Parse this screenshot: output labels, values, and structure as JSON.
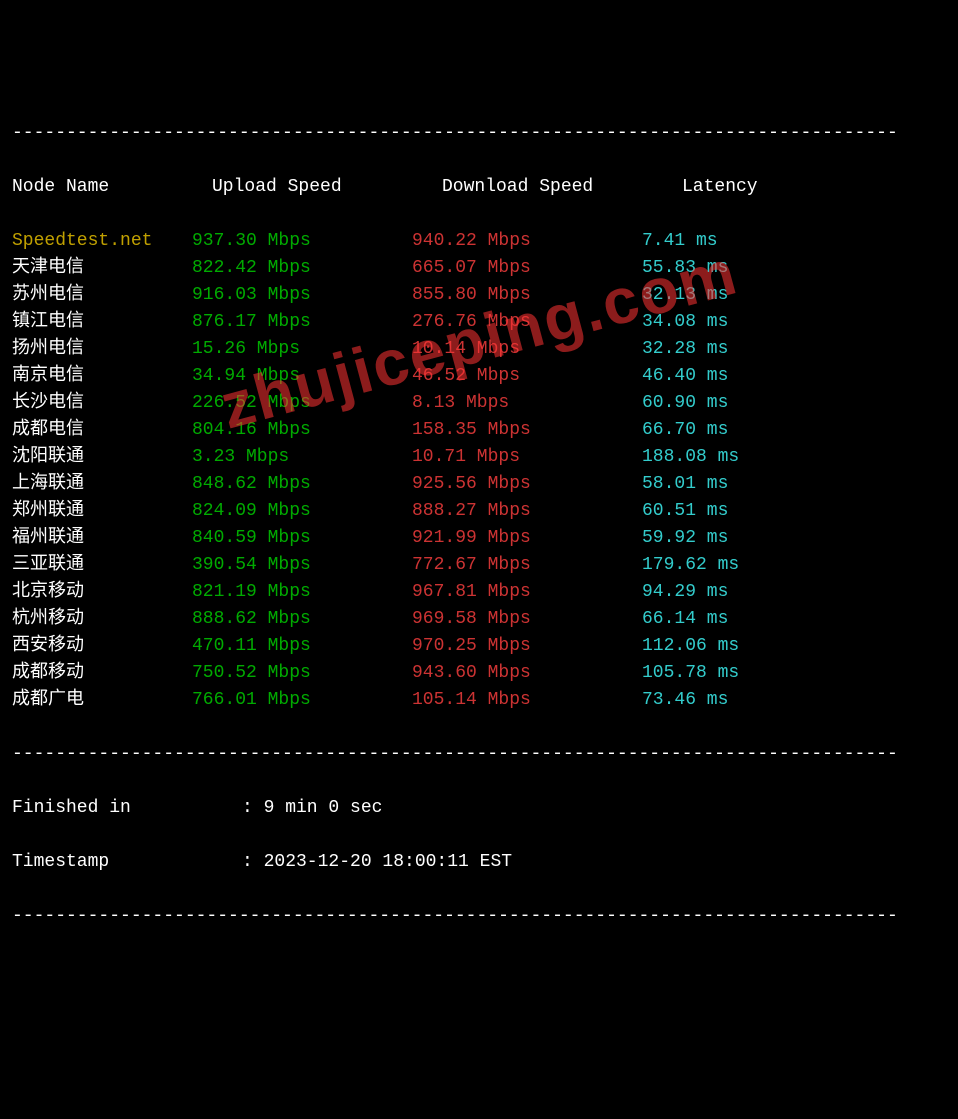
{
  "divider": "----------------------------------------------------------------------------------",
  "headers": {
    "node": "Node Name",
    "upload": "Upload Speed",
    "download": "Download Speed",
    "latency": "Latency"
  },
  "chart_data": {
    "type": "table",
    "columns": [
      "Node Name",
      "Upload Speed",
      "Download Speed",
      "Latency"
    ],
    "rows": [
      {
        "node": "Speedtest.net",
        "node_color": "yellow",
        "upload": "937.30 Mbps",
        "download": "940.22 Mbps",
        "latency": "7.41 ms"
      },
      {
        "node": "天津电信",
        "node_color": "white",
        "upload": "822.42 Mbps",
        "download": "665.07 Mbps",
        "latency": "55.83 ms"
      },
      {
        "node": "苏州电信",
        "node_color": "white",
        "upload": "916.03 Mbps",
        "download": "855.80 Mbps",
        "latency": "32.13 ms"
      },
      {
        "node": "镇江电信",
        "node_color": "white",
        "upload": "876.17 Mbps",
        "download": "276.76 Mbps",
        "latency": "34.08 ms"
      },
      {
        "node": "扬州电信",
        "node_color": "white",
        "upload": "15.26 Mbps",
        "download": "10.14 Mbps",
        "latency": "32.28 ms"
      },
      {
        "node": "南京电信",
        "node_color": "white",
        "upload": "34.94 Mbps",
        "download": "46.52 Mbps",
        "latency": "46.40 ms"
      },
      {
        "node": "长沙电信",
        "node_color": "white",
        "upload": "226.52 Mbps",
        "download": "8.13 Mbps",
        "latency": "60.90 ms"
      },
      {
        "node": "成都电信",
        "node_color": "white",
        "upload": "804.16 Mbps",
        "download": "158.35 Mbps",
        "latency": "66.70 ms"
      },
      {
        "node": "沈阳联通",
        "node_color": "white",
        "upload": "3.23 Mbps",
        "download": "10.71 Mbps",
        "latency": "188.08 ms"
      },
      {
        "node": "上海联通",
        "node_color": "white",
        "upload": "848.62 Mbps",
        "download": "925.56 Mbps",
        "latency": "58.01 ms"
      },
      {
        "node": "郑州联通",
        "node_color": "white",
        "upload": "824.09 Mbps",
        "download": "888.27 Mbps",
        "latency": "60.51 ms"
      },
      {
        "node": "福州联通",
        "node_color": "white",
        "upload": "840.59 Mbps",
        "download": "921.99 Mbps",
        "latency": "59.92 ms"
      },
      {
        "node": "三亚联通",
        "node_color": "white",
        "upload": "390.54 Mbps",
        "download": "772.67 Mbps",
        "latency": "179.62 ms"
      },
      {
        "node": "北京移动",
        "node_color": "white",
        "upload": "821.19 Mbps",
        "download": "967.81 Mbps",
        "latency": "94.29 ms"
      },
      {
        "node": "杭州移动",
        "node_color": "white",
        "upload": "888.62 Mbps",
        "download": "969.58 Mbps",
        "latency": "66.14 ms"
      },
      {
        "node": "西安移动",
        "node_color": "white",
        "upload": "470.11 Mbps",
        "download": "970.25 Mbps",
        "latency": "112.06 ms"
      },
      {
        "node": "成都移动",
        "node_color": "white",
        "upload": "750.52 Mbps",
        "download": "943.60 Mbps",
        "latency": "105.78 ms"
      },
      {
        "node": "成都广电",
        "node_color": "white",
        "upload": "766.01 Mbps",
        "download": "105.14 Mbps",
        "latency": "73.46 ms"
      }
    ]
  },
  "footer": {
    "finished_label": "Finished in",
    "finished_value": ": 9 min 0 sec",
    "timestamp_label": "Timestamp",
    "timestamp_value": ": 2023-12-20 18:00:11 EST"
  },
  "watermark": "zhujiceping.com"
}
